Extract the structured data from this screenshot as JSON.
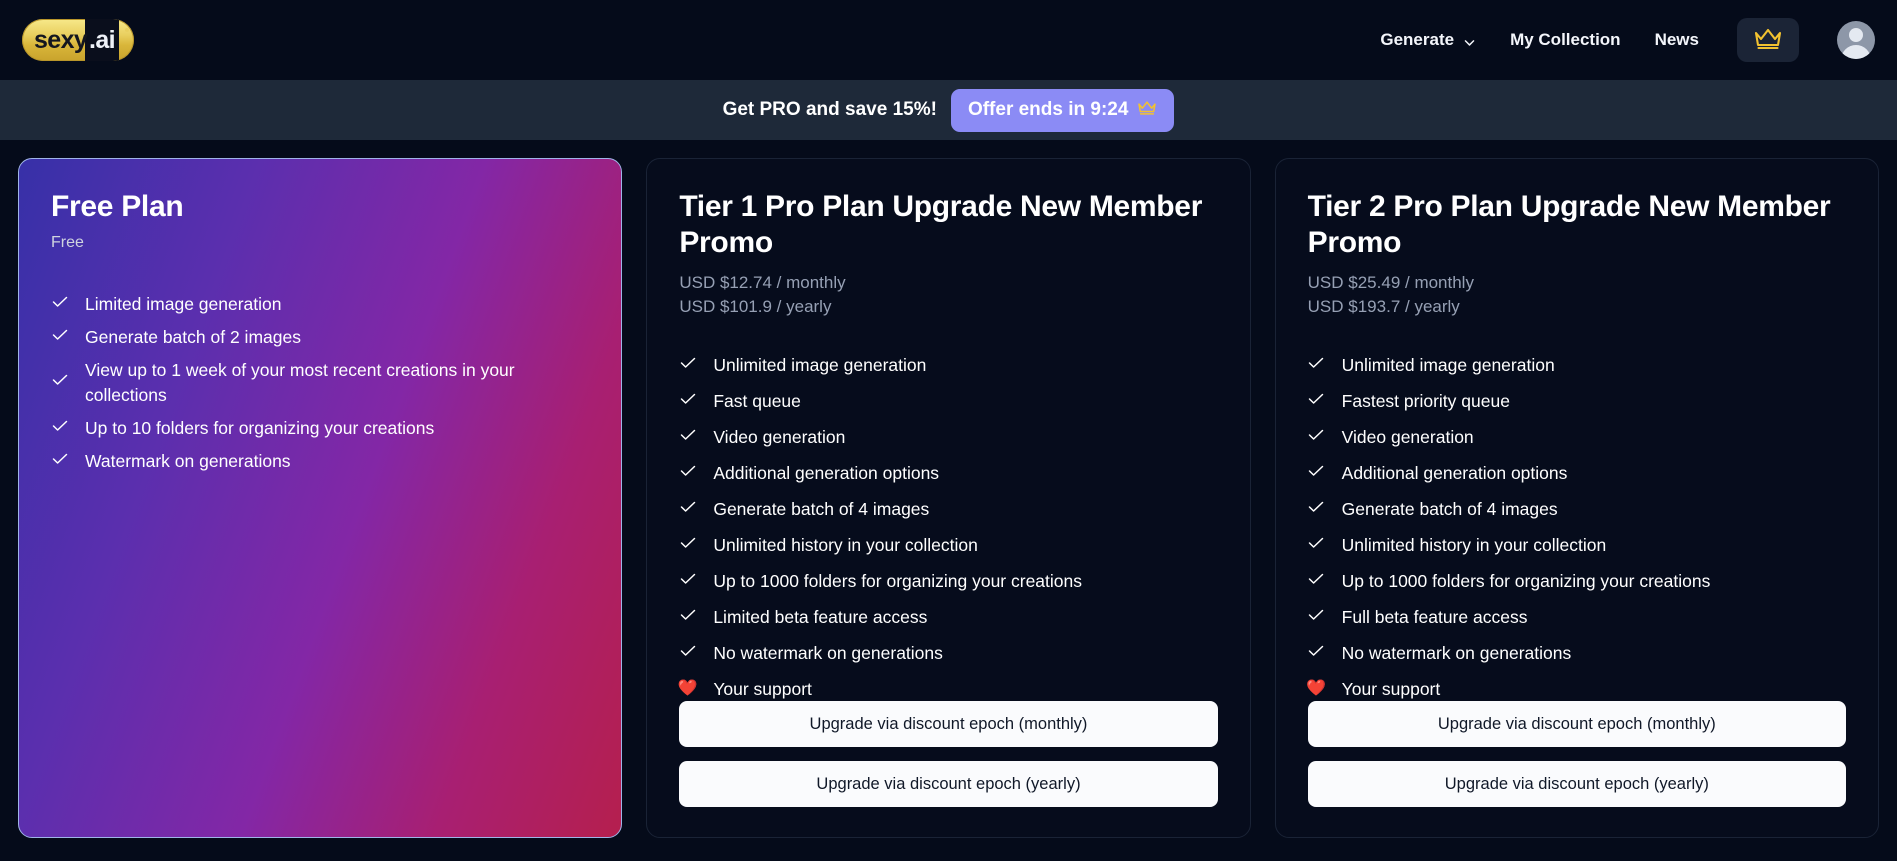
{
  "brand": {
    "logo_primary": "sexy",
    "logo_suffix": ".ai"
  },
  "nav": {
    "items": [
      {
        "label": "Generate",
        "icon": "chevron-down-icon",
        "has_dropdown": true
      },
      {
        "label": "My Collection",
        "has_dropdown": false
      },
      {
        "label": "News",
        "has_dropdown": false
      }
    ],
    "crown_icon": "crown-icon",
    "avatar_icon": "user-avatar-icon"
  },
  "promo": {
    "headline": "Get PRO and save 15%!",
    "offer_label": "Offer ends in 9:24",
    "offer_icon": "crown-icon",
    "pill_color": "#8b8bf5",
    "banner_color": "#1e2939"
  },
  "plans": [
    {
      "id": "free-plan",
      "title": "Free Plan",
      "subtitle": "Free",
      "prices": [],
      "features": [
        {
          "icon": "check-icon",
          "text": "Limited image generation"
        },
        {
          "icon": "check-icon",
          "text": "Generate batch of 2 images"
        },
        {
          "icon": "check-icon",
          "text": "View up to 1 week of your most recent creations in your collections"
        },
        {
          "icon": "check-icon",
          "text": "Up to 10 folders for organizing your creations"
        },
        {
          "icon": "check-icon",
          "text": "Watermark on generations"
        }
      ],
      "buttons": []
    },
    {
      "id": "tier-1-pro",
      "title": "Tier 1 Pro Plan Upgrade New Member Promo",
      "subtitle": "",
      "prices": [
        "USD $12.74 / monthly",
        "USD $101.9 / yearly"
      ],
      "features": [
        {
          "icon": "check-icon",
          "text": "Unlimited image generation"
        },
        {
          "icon": "check-icon",
          "text": "Fast queue"
        },
        {
          "icon": "check-icon",
          "text": "Video generation"
        },
        {
          "icon": "check-icon",
          "text": "Additional generation options"
        },
        {
          "icon": "check-icon",
          "text": "Generate batch of 4 images"
        },
        {
          "icon": "check-icon",
          "text": "Unlimited history in your collection"
        },
        {
          "icon": "check-icon",
          "text": "Up to 1000 folders for organizing your creations"
        },
        {
          "icon": "check-icon",
          "text": "Limited beta feature access"
        },
        {
          "icon": "check-icon",
          "text": "No watermark on generations"
        },
        {
          "icon": "heart-icon",
          "text": "Your support"
        }
      ],
      "buttons": [
        "Upgrade via discount epoch (monthly)",
        "Upgrade via discount epoch (yearly)"
      ]
    },
    {
      "id": "tier-2-pro",
      "title": "Tier 2 Pro Plan Upgrade New Member Promo",
      "subtitle": "",
      "prices": [
        "USD $25.49 / monthly",
        "USD $193.7 / yearly"
      ],
      "features": [
        {
          "icon": "check-icon",
          "text": "Unlimited image generation"
        },
        {
          "icon": "check-icon",
          "text": "Fastest priority queue"
        },
        {
          "icon": "check-icon",
          "text": "Video generation"
        },
        {
          "icon": "check-icon",
          "text": "Additional generation options"
        },
        {
          "icon": "check-icon",
          "text": "Generate batch of 4 images"
        },
        {
          "icon": "check-icon",
          "text": "Unlimited history in your collection"
        },
        {
          "icon": "check-icon",
          "text": "Up to 1000 folders for organizing your creations"
        },
        {
          "icon": "check-icon",
          "text": "Full beta feature access"
        },
        {
          "icon": "check-icon",
          "text": "No watermark on generations"
        },
        {
          "icon": "heart-icon",
          "text": "Your support"
        }
      ],
      "buttons": [
        "Upgrade via discount epoch (monthly)",
        "Upgrade via discount epoch (yearly)"
      ]
    }
  ],
  "colors": {
    "page_background": "#050b1a",
    "card_pro_background": "#060c1c",
    "accent_gold": "#f2c230",
    "accent_purple": "#8b8bf5",
    "cta_background": "#fafbfd"
  }
}
